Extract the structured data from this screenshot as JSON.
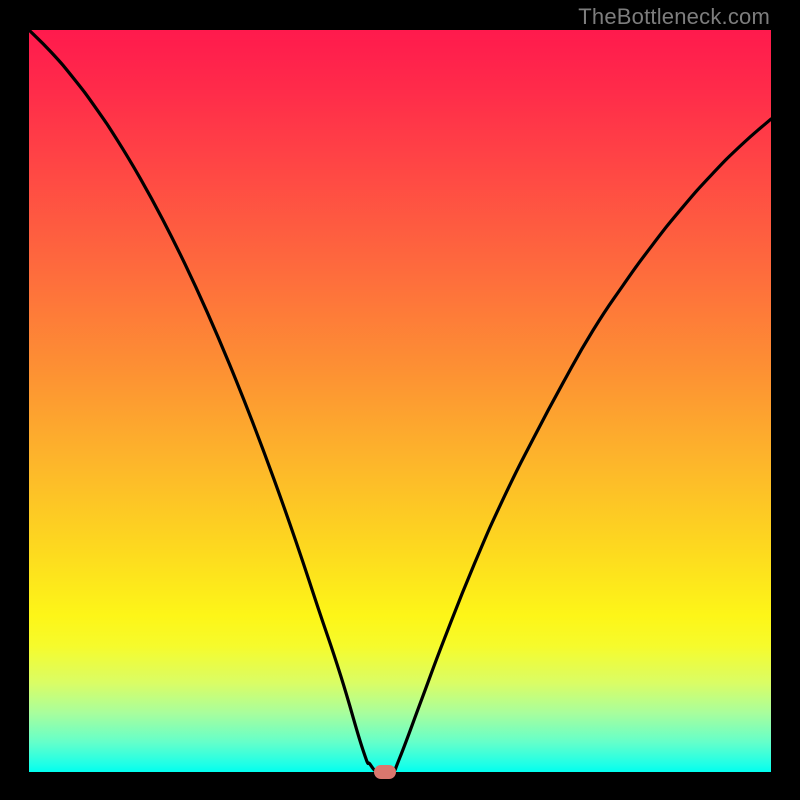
{
  "watermark": "TheBottleneck.com",
  "colors": {
    "frame": "#000000",
    "curve": "#000000",
    "marker": "#d9776e"
  },
  "chart_data": {
    "type": "line",
    "title": "",
    "xlabel": "",
    "ylabel": "",
    "xlim": [
      0,
      100
    ],
    "ylim": [
      0,
      100
    ],
    "grid": false,
    "x": [
      0,
      3,
      6,
      9,
      12,
      15,
      18,
      21,
      24,
      27,
      30,
      33,
      36,
      39,
      42,
      45,
      46,
      47,
      48,
      49,
      50,
      53,
      56,
      60,
      64,
      68,
      72,
      76,
      80,
      84,
      88,
      92,
      96,
      100
    ],
    "values": [
      100,
      97,
      93.5,
      89.5,
      85,
      80,
      74.5,
      68.5,
      62,
      55,
      47.5,
      39.5,
      31,
      22,
      13,
      3,
      1,
      0,
      0,
      0,
      2,
      10,
      18,
      28,
      37,
      45,
      52.5,
      59.5,
      65.5,
      71,
      76,
      80.5,
      84.5,
      88
    ],
    "marker": {
      "x": 48,
      "y": 0
    }
  }
}
